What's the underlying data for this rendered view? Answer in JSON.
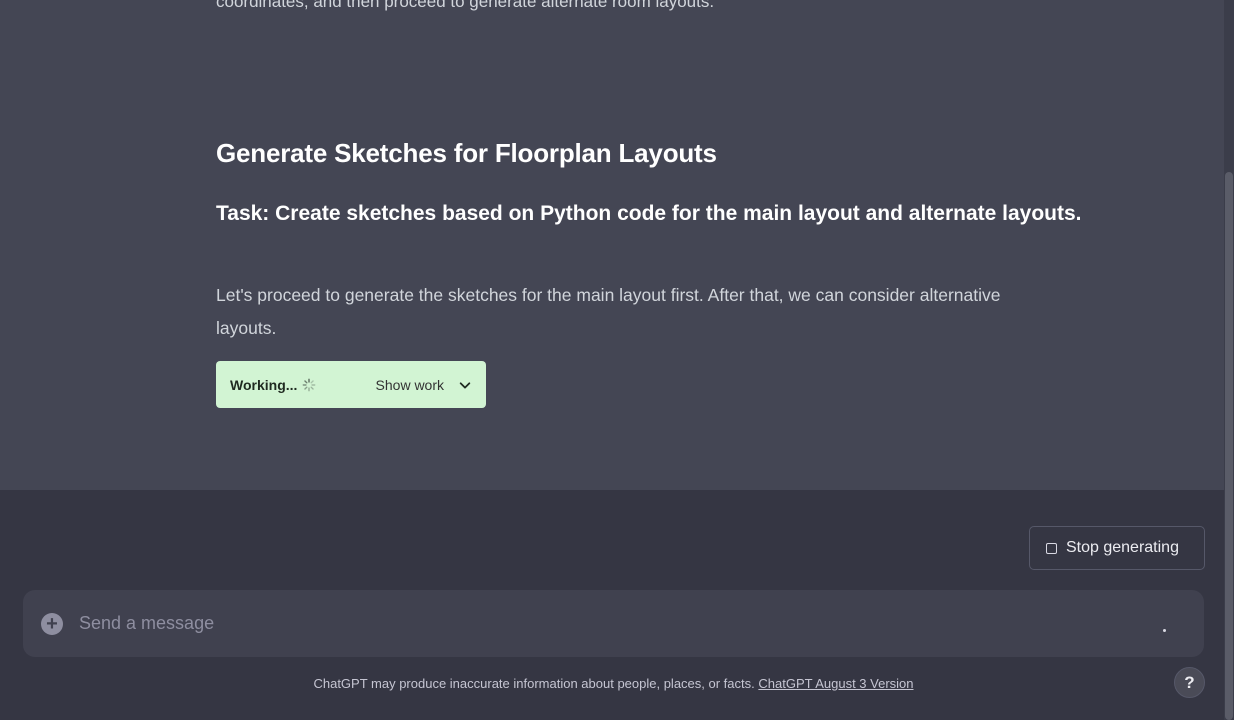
{
  "message": {
    "previous_line": "coordinates, and then proceed to generate alternate room layouts.",
    "heading": "Generate Sketches for Floorplan Layouts",
    "subheading": "Task: Create sketches based on Python code for the main layout and alternate layouts.",
    "paragraph": "Let's proceed to generate the sketches for the main layout first. After that, we can consider alternative layouts.",
    "working": {
      "label": "Working...",
      "show_work_label": "Show work"
    }
  },
  "composer": {
    "stop_label": "Stop generating",
    "placeholder": "Send a message"
  },
  "footer": {
    "disclaimer": "ChatGPT may produce inaccurate information about people, places, or facts.",
    "version_link": "ChatGPT August 3 Version",
    "help_label": "?"
  },
  "colors": {
    "chat_bg": "#444654",
    "bottom_bg": "#353643",
    "working_bg": "#d2f4d3"
  }
}
